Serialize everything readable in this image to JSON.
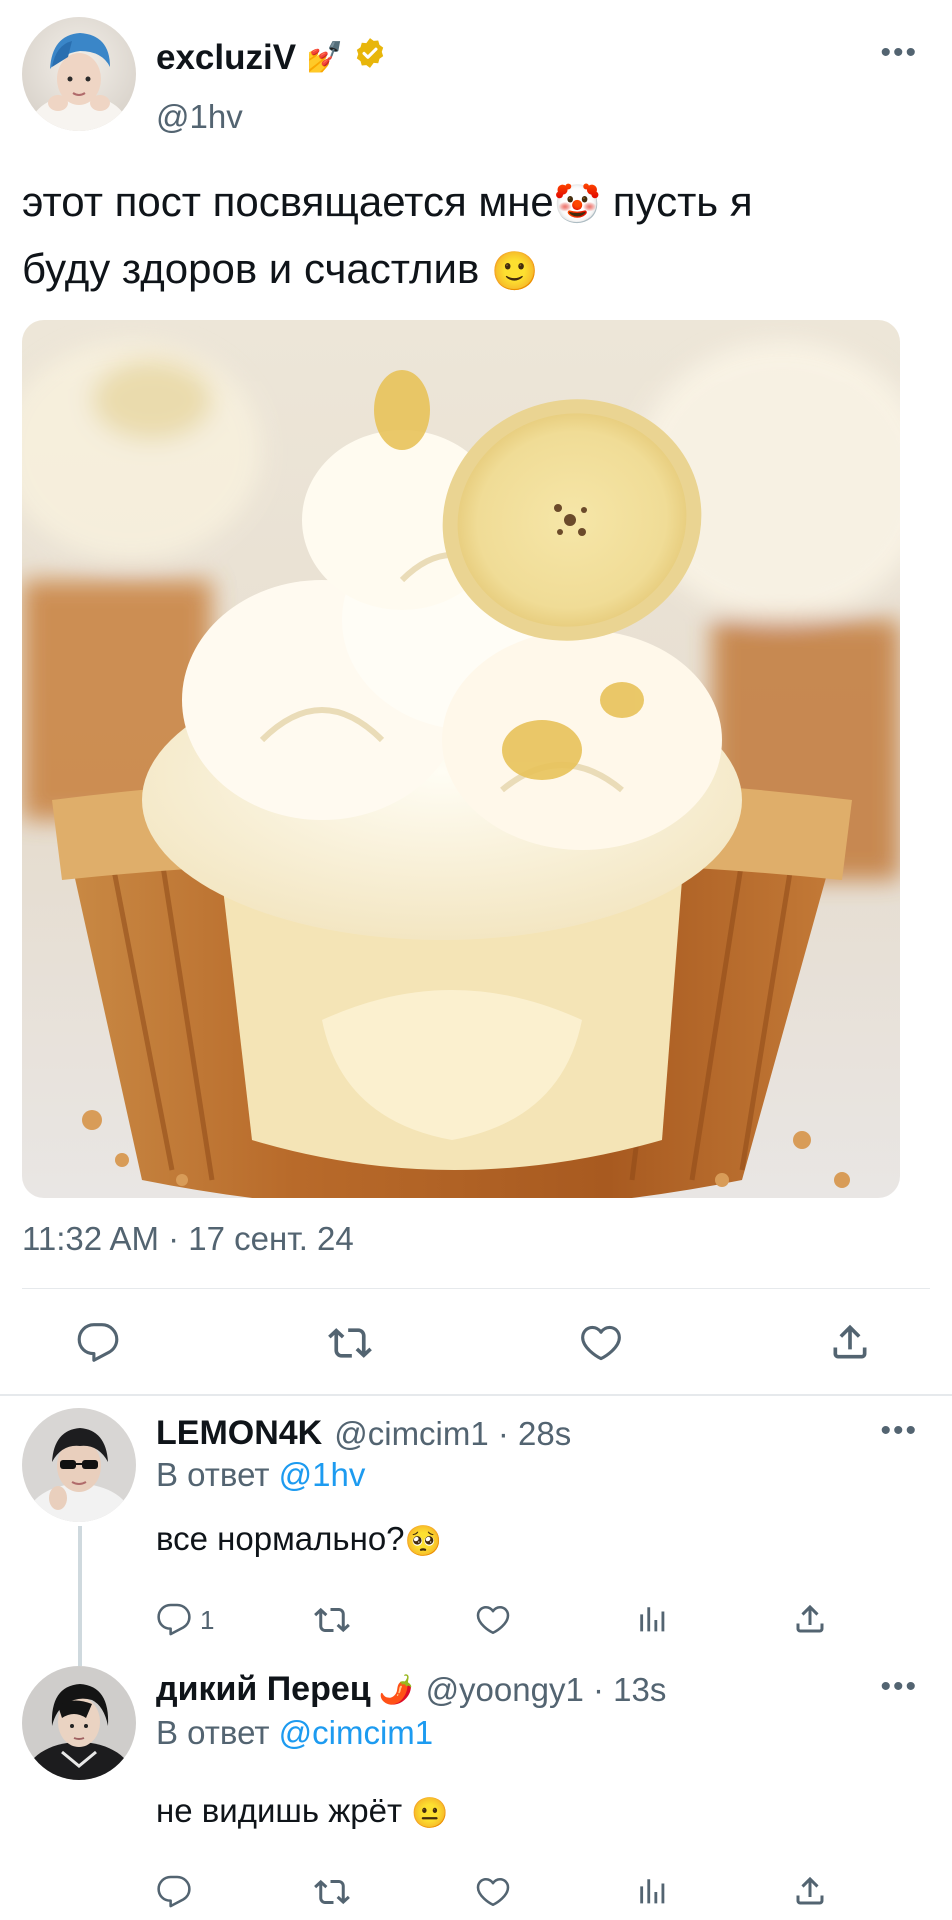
{
  "tweet": {
    "author_name": "excluziV",
    "author_handle": "@1hv",
    "name_emoji": "💅",
    "text_line1": "этот пост посвящается мне",
    "text_line1_emoji": "🤡",
    "text_line1_tail": "пусть я",
    "text_line2": "буду здоров и счастлив",
    "text_line2_emoji": "🙂",
    "timestamp": "11:32 AM · 17 сент. 24",
    "more_label": "•••"
  },
  "replies": [
    {
      "name": "LEMON4K",
      "meta": "@cimcim1 · 28s",
      "reply_to_prefix": "В ответ",
      "reply_to_mention": "@1hv",
      "text": "все нормально?",
      "text_emoji": "🥺",
      "reply_count": "1",
      "more_label": "•••"
    },
    {
      "name": "дикий Перец",
      "name_emoji": "🌶️",
      "meta": "@yoongy1 · 13s",
      "reply_to_prefix": "В ответ",
      "reply_to_mention": "@cimcim1",
      "text": "не видишь жрёт",
      "text_emoji": "😐",
      "more_label": "•••"
    }
  ],
  "colors": {
    "text_primary": "#0f1419",
    "text_secondary": "#536471",
    "link": "#1d9bf0",
    "verified_badge": "#e8b60b",
    "divider": "#e6e9ec"
  },
  "icons": [
    "reply-icon",
    "retweet-icon",
    "like-icon",
    "share-icon",
    "views-icon",
    "verified-badge-icon",
    "more-icon"
  ]
}
